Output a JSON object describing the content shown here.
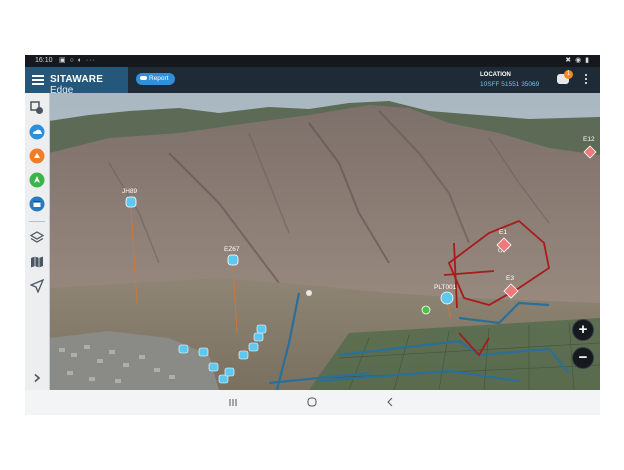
{
  "status_bar": {
    "time": "16:10",
    "left_icons": "▣ ○ ◐ ···",
    "right_icons": "✖ ◉ ▮"
  },
  "app_bar": {
    "brand_main": "SITAWARE",
    "brand_sub": " Edge",
    "report_label": "Report",
    "location_label": "LOCATION",
    "location_value": "10SFF 51551 35069",
    "chat_badge": "1"
  },
  "toolbar": {
    "icons": [
      "layers-stack-icon",
      "cloud-icon",
      "orange-action-icon",
      "green-navigation-icon",
      "calendar-icon",
      "layers-icon",
      "map-icon",
      "locate-icon"
    ],
    "expand_icon": "chevron-right-icon"
  },
  "map": {
    "markers": [
      {
        "id": "JH89",
        "label": "JH89"
      },
      {
        "id": "EZ67",
        "label": "EZ67"
      },
      {
        "id": "PLT001",
        "label": "PLT001"
      },
      {
        "id": "E12",
        "label": "E12"
      },
      {
        "id": "E1",
        "label": "E1"
      },
      {
        "id": "E3",
        "label": "E3"
      }
    ],
    "zoom_in": "+",
    "zoom_out": "−",
    "colors": {
      "friendly": "#5fc8f0",
      "hostile": "#f07a7a",
      "route": "#2a6f9a",
      "boundary": "#b02020"
    }
  },
  "nav_bar": {
    "recent": "recents-icon",
    "home": "home-icon",
    "back": "back-icon"
  }
}
